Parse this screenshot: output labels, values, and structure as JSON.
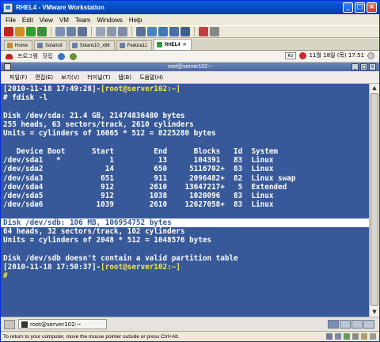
{
  "window": {
    "title": "RHEL4 - VMware Workstation"
  },
  "menubar": {
    "items": [
      "File",
      "Edit",
      "View",
      "VM",
      "Team",
      "Windows",
      "Help"
    ]
  },
  "tabs": [
    {
      "label": "Home",
      "active": false
    },
    {
      "label": "Solaris9",
      "active": false
    },
    {
      "label": "Solaris10_x86",
      "active": false
    },
    {
      "label": "Fedora11",
      "active": false
    },
    {
      "label": "RHEL4",
      "active": true
    }
  ],
  "guest_panel": {
    "menu_applications": "프로그램",
    "menu_places": "장립",
    "tray_input_method": "Ko",
    "tray_datetime": "11월 18일 (목) 17:51"
  },
  "terminal_window": {
    "title": "root@server102:~",
    "menus": [
      "파일(F)",
      "편집(E)",
      "보기(V)",
      "터미널(T)",
      "탭(B)",
      "도움말(H)"
    ]
  },
  "terminal": {
    "lines": [
      {
        "pre": "[2010-11-18 17:49:28]-",
        "hl_y": "[root@server102:~]",
        "text": ""
      },
      {
        "text": "# fdisk -l"
      },
      {
        "text": ""
      },
      {
        "text": "Disk /dev/sda: 21.4 GB, 21474836480 bytes"
      },
      {
        "text": "255 heads, 63 sectors/track, 2610 cylinders"
      },
      {
        "text": "Units = cylinders of 16065 * 512 = 8225280 bytes"
      },
      {
        "text": ""
      },
      {
        "text": "   Device Boot      Start         End      Blocks   Id  System"
      },
      {
        "text": "/dev/sda1   *           1          13      104391   83  Linux"
      },
      {
        "text": "/dev/sda2              14         650     5116702+  83  Linux"
      },
      {
        "text": "/dev/sda3             651         911     2096482+  82  Linux swap"
      },
      {
        "text": "/dev/sda4             912        2610    13647217+   5  Extended"
      },
      {
        "text": "/dev/sda5             912        1038     1020096   83  Linux"
      },
      {
        "text": "/dev/sda6            1039        2610    12627058+  83  Linux"
      },
      {
        "text": ""
      },
      {
        "text": "Disk /dev/sdb: 106 MB, 106954752 bytes",
        "highlight": true
      },
      {
        "text": "64 heads, 32 sectors/track, 102 cylinders"
      },
      {
        "text": "Units = cylinders of 2048 * 512 = 1048576 bytes"
      },
      {
        "text": ""
      },
      {
        "text": "Disk /dev/sdb doesn't contain a valid partition table"
      },
      {
        "pre": "[2010-11-18 17:50:37]-",
        "hl_y": "[root@server102:~]",
        "text": ""
      },
      {
        "prompt": "#",
        "text": ""
      }
    ]
  },
  "taskbar": {
    "task_label": "root@server102:~"
  },
  "statusbar": {
    "text": "To return to your computer, move the mouse pointer outside or press Ctrl+Alt."
  },
  "colors": {
    "terminal_bg": "#375999",
    "prompt_yellow": "#f3e64a"
  }
}
